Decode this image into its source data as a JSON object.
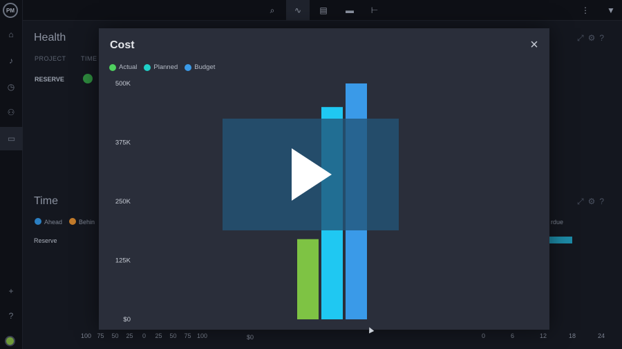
{
  "app": {
    "logo": "PM"
  },
  "rail": {
    "icons": [
      "home-icon",
      "bell-icon",
      "clock-icon",
      "team-icon",
      "briefcase-icon",
      "plus-icon",
      "help-icon"
    ]
  },
  "topbar": {
    "icons": [
      "search-doc-icon",
      "pulse-icon",
      "clipboard-icon",
      "timeline-icon",
      "workflow-icon",
      "more-icon",
      "filter-icon"
    ],
    "more_glyph": "⋮"
  },
  "health": {
    "title": "Health",
    "col_project": "PROJECT",
    "col_time": "TIME",
    "row_label": "RESERVE",
    "status_color": "#2e8b3e"
  },
  "time_panel": {
    "title": "Time",
    "legend": [
      {
        "label": "Ahead",
        "color": "#2b7fc2"
      },
      {
        "label": "Behin",
        "color": "#c27b2b"
      }
    ],
    "row_label": "Reserve",
    "overdue_label": "rdue",
    "bar_color": "#1d8aa6"
  },
  "bottom_axes": {
    "left_ticks": [
      "100",
      "75",
      "50",
      "25",
      "0",
      "25",
      "50",
      "75",
      "100"
    ],
    "middle_tick": "$0",
    "right_ticks": [
      "0",
      "6",
      "12",
      "18",
      "24"
    ]
  },
  "modal": {
    "title": "Cost",
    "close_glyph": "×"
  },
  "chart_data": {
    "type": "bar",
    "title": "Cost",
    "categories": [
      ""
    ],
    "series": [
      {
        "name": "Actual",
        "color": "#7ec344",
        "values": [
          170000
        ]
      },
      {
        "name": "Planned",
        "color": "#1fc8f2",
        "values": [
          450000
        ]
      },
      {
        "name": "Budget",
        "color": "#3a9ae8",
        "values": [
          500000
        ]
      }
    ],
    "legend_colors": [
      "#4fd05f",
      "#1fd0c8",
      "#3a9ae8"
    ],
    "yticks": [
      "$0",
      "125K",
      "250K",
      "375K",
      "500K"
    ],
    "ylim": [
      0,
      500000
    ],
    "grid": false,
    "legend_placement": "top-left"
  },
  "overlay": {
    "type": "video-play-button"
  }
}
